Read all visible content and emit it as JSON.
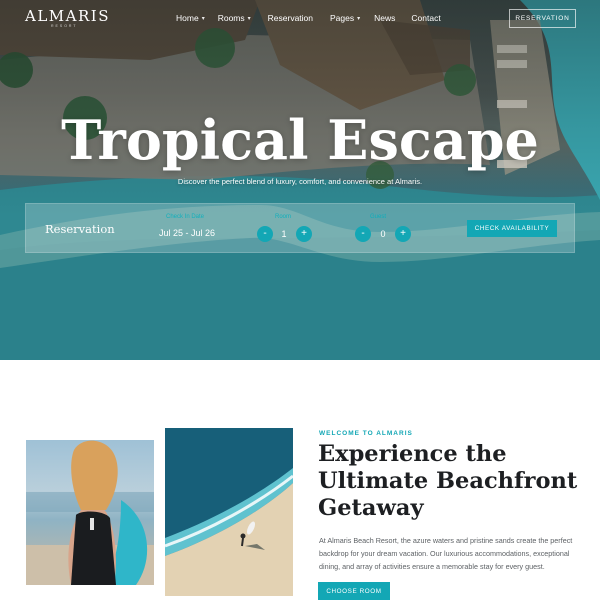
{
  "brand": {
    "logo": "ALMARIS",
    "logo_sub": "RESORT"
  },
  "nav": {
    "items": [
      {
        "label": "Home",
        "has_dropdown": true
      },
      {
        "label": "Rooms",
        "has_dropdown": true
      },
      {
        "label": "Reservation",
        "has_dropdown": false
      },
      {
        "label": "Pages",
        "has_dropdown": true
      },
      {
        "label": "News",
        "has_dropdown": false
      },
      {
        "label": "Contact",
        "has_dropdown": false
      }
    ],
    "cta": "RESERVATION",
    "dropdown_icon": "chevron-down-icon"
  },
  "hero": {
    "title": "Tropical Escape",
    "subtitle": "Discover the perfect blend of luxury, comfort, and convenience at Almaris."
  },
  "booking": {
    "label": "Reservation",
    "date_label": "Check In Date",
    "date_value": "Jul 25 - Jul 26",
    "room_label": "Room",
    "room_value": "1",
    "guest_label": "Guest",
    "guest_value": "0",
    "minus": "-",
    "plus": "+",
    "submit": "CHECK AVAILABILITY"
  },
  "welcome": {
    "eyebrow": "WELCOME TO ALMARIS",
    "heading": "Experience the Ultimate Beachfront Getaway",
    "body": "At Almaris Beach Resort, the azure waters and pristine sands create the perfect backdrop for your dream vacation. Our luxurious accommodations, exceptional dining, and array of activities ensure a memorable stay for every guest.",
    "button": "CHOOSE ROOM"
  },
  "colors": {
    "accent": "#13a7b5",
    "heading": "#1d1f22",
    "body": "#5d6165"
  }
}
